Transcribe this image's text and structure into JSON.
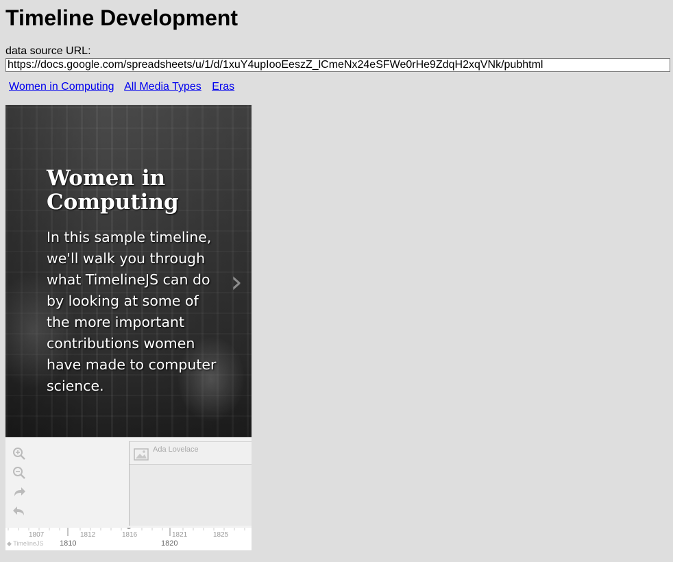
{
  "page": {
    "title": "Timeline Development",
    "source_label": "data source URL:",
    "source_url": "https://docs.google.com/spreadsheets/u/1/d/1xuY4upIooEeszZ_lCmeNx24eSFWe0rHe9ZdqH2xqVNk/pubhtml"
  },
  "links": [
    "Women in Computing",
    "All Media Types",
    "Eras"
  ],
  "slide": {
    "title": "Women in Computing",
    "text": "In this sample timeline, we'll walk you through what TimelineJS can do by looking at some of the more important contributions women have made to computer science."
  },
  "timenav": {
    "marker_label": "Ada Lovelace",
    "minor_ticks": [
      "1807",
      "1812",
      "1816",
      "1821",
      "1825"
    ],
    "major_ticks": [
      "1810",
      "1820"
    ],
    "brand": "TimelineJS",
    "icons": [
      "zoom-in-icon",
      "zoom-out-icon",
      "forward-icon",
      "back-icon",
      "image-icon",
      "next-arrow-icon"
    ]
  }
}
